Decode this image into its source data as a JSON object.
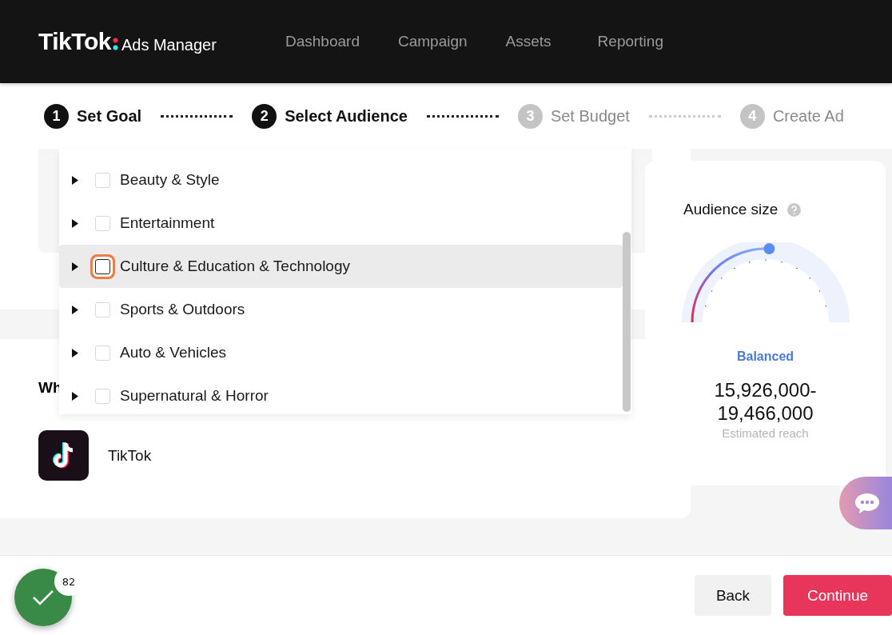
{
  "header": {
    "logo": "TikTok",
    "product": "Ads Manager",
    "nav": [
      {
        "label": "Dashboard",
        "selected": false
      },
      {
        "label": "Campaign",
        "selected": false
      },
      {
        "label": "Assets",
        "selected": false
      },
      {
        "label": "Reporting",
        "selected": false
      }
    ]
  },
  "steps": [
    {
      "number": "1",
      "label": "Set Goal",
      "active": true
    },
    {
      "number": "2",
      "label": "Select Audience",
      "active": true
    },
    {
      "number": "3",
      "label": "Set Budget",
      "active": false
    },
    {
      "number": "4",
      "label": "Create Ad",
      "active": false
    }
  ],
  "dropdown": {
    "items": [
      {
        "label": "Beauty & Style",
        "checked": false,
        "selected": false
      },
      {
        "label": "Entertainment",
        "checked": false,
        "selected": false
      },
      {
        "label": "Culture & Education & Technology",
        "checked": false,
        "selected": true
      },
      {
        "label": "Sports & Outdoors",
        "checked": false,
        "selected": false
      },
      {
        "label": "Auto & Vehicles",
        "checked": false,
        "selected": false
      },
      {
        "label": "Supernatural & Horror",
        "checked": false,
        "selected": false
      }
    ]
  },
  "placement": {
    "heading": "Wh",
    "app": "TikTok"
  },
  "audience": {
    "title": "Audience size",
    "status": "Balanced",
    "range": "15,926,000-\n19,466,000",
    "caption": "Estimated reach"
  },
  "footer": {
    "badge": "82",
    "back": "Back",
    "continue": "Continue"
  }
}
